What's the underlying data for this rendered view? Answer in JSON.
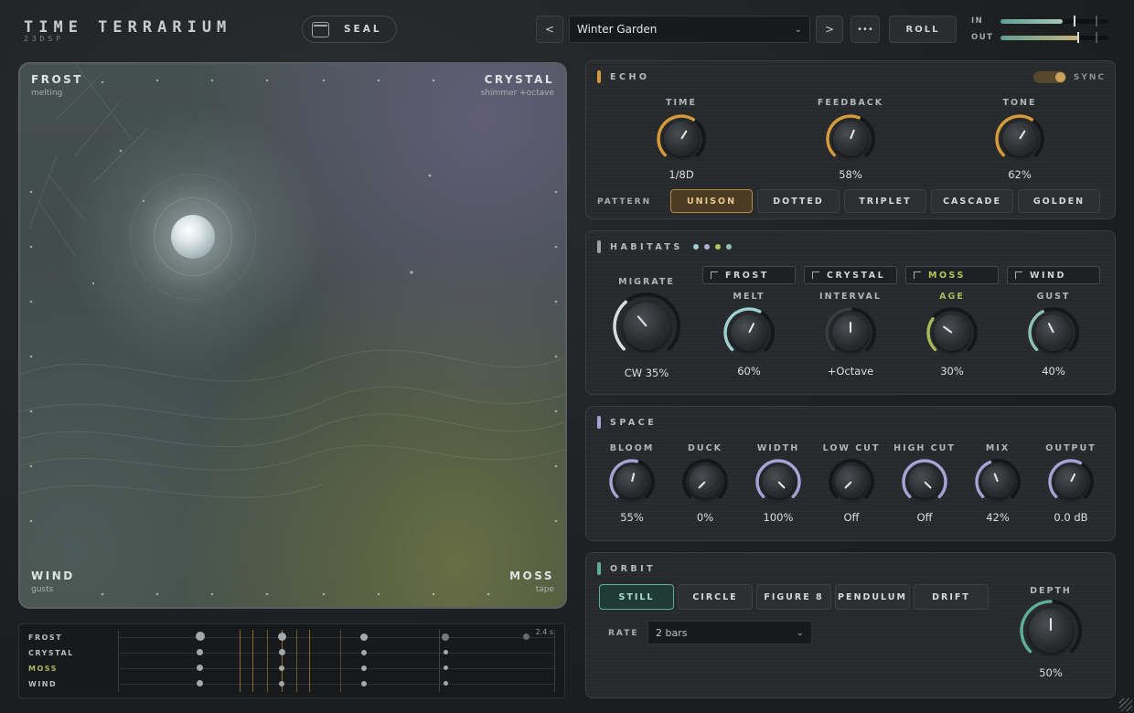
{
  "header": {
    "logo_title": "TIME TERRARIUM",
    "logo_sub": "23DSP",
    "seal_label": "SEAL",
    "prev": "<",
    "next": ">",
    "more": "•••",
    "preset": "Winter Garden",
    "roll": "ROLL",
    "meter_in": "IN",
    "meter_out": "OUT",
    "in_level": 0.58,
    "out_level": 0.72
  },
  "pad": {
    "frost": "FROST",
    "frost_sub": "melting",
    "crystal": "CRYSTAL",
    "crystal_sub": "shimmer +octave",
    "wind": "WIND",
    "wind_sub": "gusts",
    "moss": "MOSS",
    "moss_sub": "tape"
  },
  "timeline": {
    "rows": [
      "FROST",
      "CRYSTAL",
      "MOSS",
      "WIND"
    ],
    "time": "2.4 s"
  },
  "echo": {
    "title": "ECHO",
    "sync": "SYNC",
    "knobs": [
      {
        "label": "TIME",
        "value": "1/8D",
        "level": 0.62
      },
      {
        "label": "FEEDBACK",
        "value": "58%",
        "level": 0.58
      },
      {
        "label": "TONE",
        "value": "62%",
        "level": 0.62
      }
    ],
    "pattern_label": "PATTERN",
    "patterns": [
      "UNISON",
      "DOTTED",
      "TRIPLET",
      "CASCADE",
      "GOLDEN"
    ],
    "active_pattern": "UNISON"
  },
  "habitats": {
    "title": "HABITATS",
    "migrate_label": "MIGRATE",
    "migrate_value": "CW 35%",
    "buttons": [
      "FROST",
      "CRYSTAL",
      "MOSS",
      "WIND"
    ],
    "knobs": [
      {
        "label": "MELT",
        "value": "60%",
        "level": 0.6
      },
      {
        "label": "INTERVAL",
        "value": "+Octave",
        "level": 0.5
      },
      {
        "label": "AGE",
        "value": "30%",
        "level": 0.3
      },
      {
        "label": "GUST",
        "value": "40%",
        "level": 0.4
      }
    ]
  },
  "space": {
    "title": "SPACE",
    "knobs": [
      {
        "label": "BLOOM",
        "value": "55%",
        "level": 0.55
      },
      {
        "label": "DUCK",
        "value": "0%",
        "level": 0
      },
      {
        "label": "WIDTH",
        "value": "100%",
        "level": 1
      },
      {
        "label": "LOW CUT",
        "value": "Off",
        "level": 0
      },
      {
        "label": "HIGH CUT",
        "value": "Off",
        "level": 1
      },
      {
        "label": "MIX",
        "value": "42%",
        "level": 0.42
      },
      {
        "label": "OUTPUT",
        "value": "0.0 dB",
        "level": 0.6
      }
    ]
  },
  "orbit": {
    "title": "ORBIT",
    "modes": [
      "STILL",
      "CIRCLE",
      "FIGURE 8",
      "PENDULUM",
      "DRIFT"
    ],
    "active_mode": "STILL",
    "rate_label": "RATE",
    "rate_value": "2 bars",
    "depth_label": "DEPTH",
    "depth_value": "50%",
    "depth_level": 0.5
  },
  "colors": {
    "echo": "#d49a3c",
    "habitats": "#9ea3a6",
    "space": "#a7a3d6",
    "orbit": "#5fae9a",
    "frost": "#9ecfd2",
    "moss": "#b6c45c",
    "age": "#a9b85a"
  }
}
